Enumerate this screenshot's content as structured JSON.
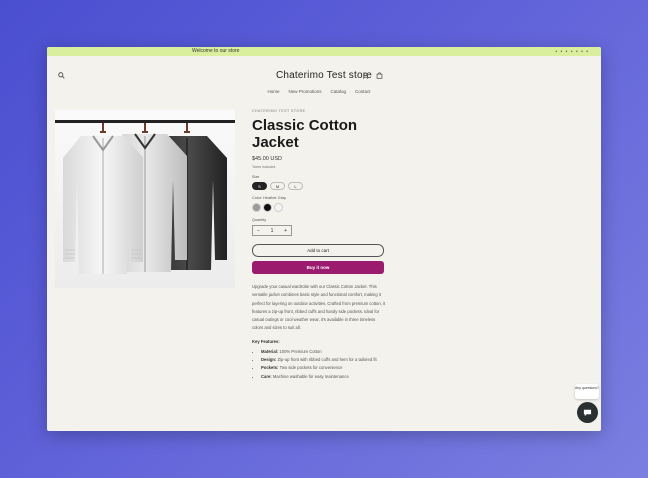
{
  "announcement": {
    "message": "Welcome to our store",
    "pager_dots": "• • • • • • •"
  },
  "header": {
    "store_name": "Chaterimo Test store",
    "search_icon": "search-icon",
    "account_icon": "user-icon",
    "cart_icon": "bag-icon"
  },
  "nav": {
    "items": [
      "Home",
      "New Promotions",
      "Catalog",
      "Contact"
    ]
  },
  "product": {
    "vendor": "CHATERIMO TEST STORE",
    "title": "Classic Cotton Jacket",
    "price": "$45.00 USD",
    "tax_note": "Taxes included.",
    "size_label": "Size",
    "sizes": [
      "S",
      "M",
      "L"
    ],
    "selected_size": "S",
    "color_label": "Color: Heather Gray",
    "colors": [
      "#9a9a9a",
      "#111111",
      "#f4f4f4"
    ],
    "quantity_label": "Quantity",
    "quantity": "1",
    "qty_minus": "−",
    "qty_plus": "+",
    "add_to_cart": "Add to cart",
    "buy_now": "Buy it now",
    "description": "Upgrade your casual wardrobe with our Classic Cotton Jacket. This versatile jacket combines basic style and functional comfort, making it perfect for layering on outdoor activities. Crafted from premium cotton, it features a zip-up front, ribbed cuffs and handy side pockets. Ideal for casual outings or cool weather wear, it's available in three timeless colors and sizes to suit all.",
    "features_title": "Key Features:",
    "features": [
      {
        "name": "Material:",
        "text": "100% Premium Cotton"
      },
      {
        "name": "Design:",
        "text": "Zip-up front with ribbed cuffs and hem for a tailored fit"
      },
      {
        "name": "Pockets:",
        "text": "Two side pockets for convenience"
      },
      {
        "name": "Care:",
        "text": "Machine washable for easy maintenance"
      }
    ]
  },
  "chat": {
    "prompt": "Any questions?",
    "icon": "chat-bubble-icon"
  }
}
